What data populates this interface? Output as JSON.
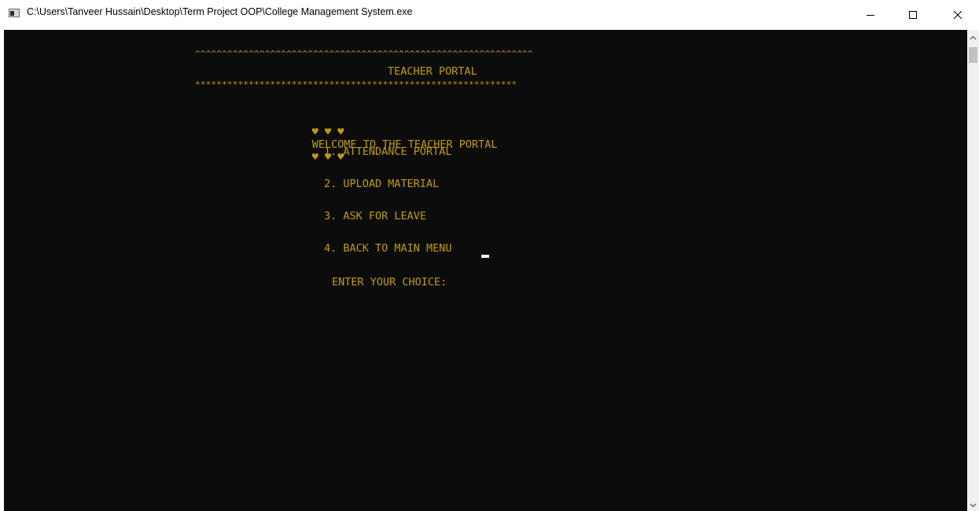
{
  "window": {
    "title": "C:\\Users\\Tanveer Hussain\\Desktop\\Term Project OOP\\College Management System.exe",
    "controls": {
      "minimize": "minimize",
      "maximize": "maximize",
      "close": "close"
    }
  },
  "console": {
    "text_color": "#c19c00",
    "background": "#0c0c0c",
    "caret_line": "^^^^^^^^^^^^^^^^^^^^^^^^^^^^^^^^^^^^^^^^^^^^^^^^^^^^^^^^^^^^^^^",
    "header": "TEACHER PORTAL",
    "star_line": "************************************************************",
    "welcome": {
      "hearts_left": "♥ ♥ ♥",
      "text": "WELCOME TO THE TEACHER PORTAL",
      "hearts_right": "♥ ♥ ♥"
    },
    "menu": [
      "1. ATTENDANCE PORTAL",
      "2. UPLOAD MATERIAL",
      "3. ASK FOR LEAVE",
      "4. BACK TO MAIN MENU"
    ],
    "prompt": "ENTER YOUR CHOICE:"
  }
}
